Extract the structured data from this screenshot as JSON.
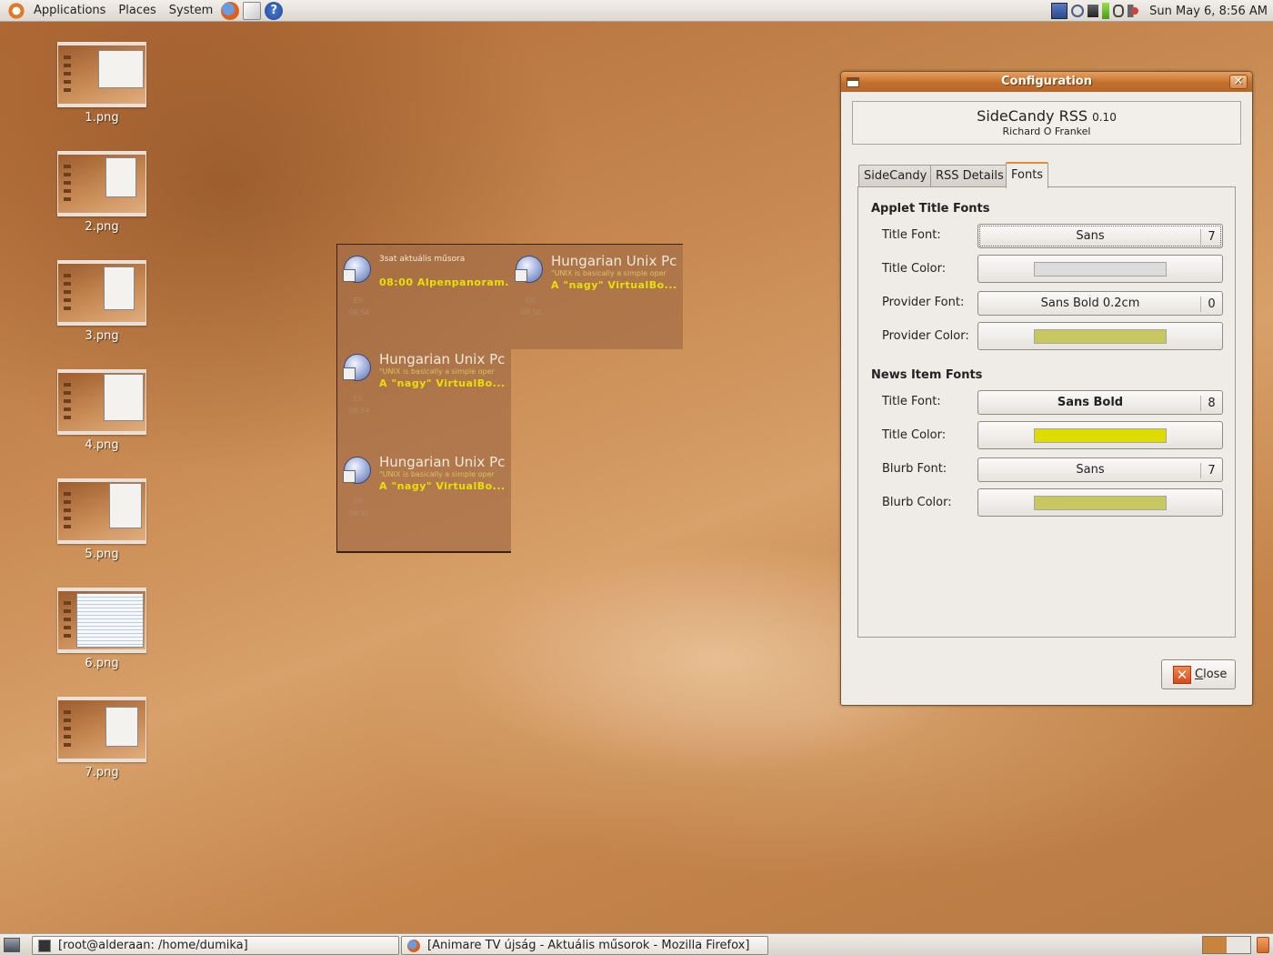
{
  "top_panel": {
    "menus": [
      "Applications",
      "Places",
      "System"
    ],
    "clock": "Sun May  6,  8:56 AM"
  },
  "desktop_icons": [
    "1.png",
    "2.png",
    "3.png",
    "4.png",
    "5.png",
    "6.png",
    "7.png"
  ],
  "sidecandy": {
    "items": [
      {
        "provider": "3sat aktuális műsora",
        "blurb": "",
        "title": "08:00 Alpenpanoram...",
        "meta1": "Ell:",
        "meta2": "08:54"
      },
      {
        "provider": "Hungarian Unix Pc",
        "blurb": "\"UNIX is basically a simple oper",
        "title": "A \"nagy\" VirtualBo...",
        "meta1": "Ell:",
        "meta2": "08:50"
      },
      {
        "provider": "Hungarian Unix Pc",
        "blurb": "\"UNIX is basically a simple oper",
        "title": "A \"nagy\" VirtualBo...",
        "meta1": "Ell:",
        "meta2": "08:54"
      },
      {
        "provider": "Hungarian Unix Pc",
        "blurb": "\"UNIX is basically a simple oper",
        "title": "A \"nagy\" VirtualBo...",
        "meta1": "Ell:",
        "meta2": "08:48"
      }
    ]
  },
  "config": {
    "window_title": "Configuration",
    "about": {
      "name": "SideCandy RSS",
      "version": "0.10",
      "author": "Richard O Frankel"
    },
    "tabs": [
      "SideCandy",
      "RSS Details",
      "Fonts"
    ],
    "active_tab": "Fonts",
    "applet_section": {
      "heading": "Applet Title Fonts",
      "title_font_label": "Title Font:",
      "title_font": "Sans",
      "title_font_size": "7",
      "title_color_label": "Title Color:",
      "title_color": "#dcdcdc",
      "provider_font_label": "Provider Font:",
      "provider_font": "Sans Bold 0.2cm",
      "provider_font_size": "0",
      "provider_color_label": "Provider Color:",
      "provider_color": "#c8c860"
    },
    "news_section": {
      "heading": "News Item Fonts",
      "title_font_label": "Title Font:",
      "title_font": "Sans Bold",
      "title_font_size": "8",
      "title_color_label": "Title Color:",
      "title_color": "#dcdc00",
      "blurb_font_label": "Blurb Font:",
      "blurb_font": "Sans",
      "blurb_font_size": "7",
      "blurb_color_label": "Blurb Color:",
      "blurb_color": "#c8c860"
    },
    "close_label": "Close"
  },
  "taskbar": [
    {
      "label": "[root@alderaan: /home/dumika]"
    },
    {
      "label": "[Animare TV újság - Aktuális műsorok - Mozilla Firefox]"
    }
  ]
}
